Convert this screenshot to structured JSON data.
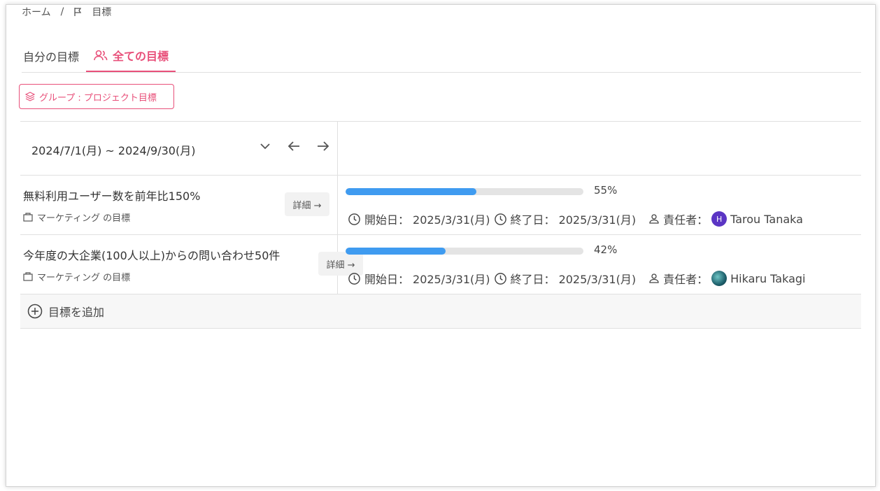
{
  "breadcrumb": {
    "items": [
      "ホーム",
      "/",
      "目標"
    ]
  },
  "tabs": [
    {
      "label": "自分の目標",
      "active": false
    },
    {
      "label": "全ての目標",
      "active": true
    }
  ],
  "group_filter": {
    "label": "グループ : プロジェクト目標"
  },
  "period": {
    "label": "2024/7/1(月) ~ 2024/9/30(月)"
  },
  "goals": [
    {
      "title": "無料利用ユーザー数を前年比150%",
      "category": "マーケティング の目標",
      "detail_label": "詳細 →",
      "progress_percent": 55,
      "progress_label": "55%",
      "start_label": "開始日：",
      "start_date": "2025/3/31(月)",
      "end_label": "終了日：",
      "end_date": "2025/3/31(月)",
      "owner_label": "責任者：",
      "owner_initial": "H",
      "owner_name": "Tarou Tanaka"
    },
    {
      "title": "今年度の大企業(100人以上)からの問い合わせ50件",
      "category": "マーケティング の目標",
      "detail_label": "詳細 →",
      "progress_percent": 42,
      "progress_label": "42%",
      "start_label": "開始日：",
      "start_date": "2025/3/31(月)",
      "end_label": "終了日：",
      "end_date": "2025/3/31(月)",
      "owner_label": "責任者：",
      "owner_name": "Hikaru Takagi"
    }
  ],
  "add_goal": {
    "label": "目標を追加"
  },
  "colors": {
    "accent": "#e8507a",
    "progress": "#3f9bf0",
    "avatar_tarou": "#5b35c4",
    "avatar_hikaru": "#1d5f6b"
  },
  "icons": [
    "home-icon",
    "flag-icon",
    "users-icon",
    "layers-icon",
    "chevron-down-icon",
    "arrow-left-icon",
    "arrow-right-icon",
    "folder-icon",
    "clock-icon",
    "user-icon",
    "plus-circle-icon"
  ]
}
